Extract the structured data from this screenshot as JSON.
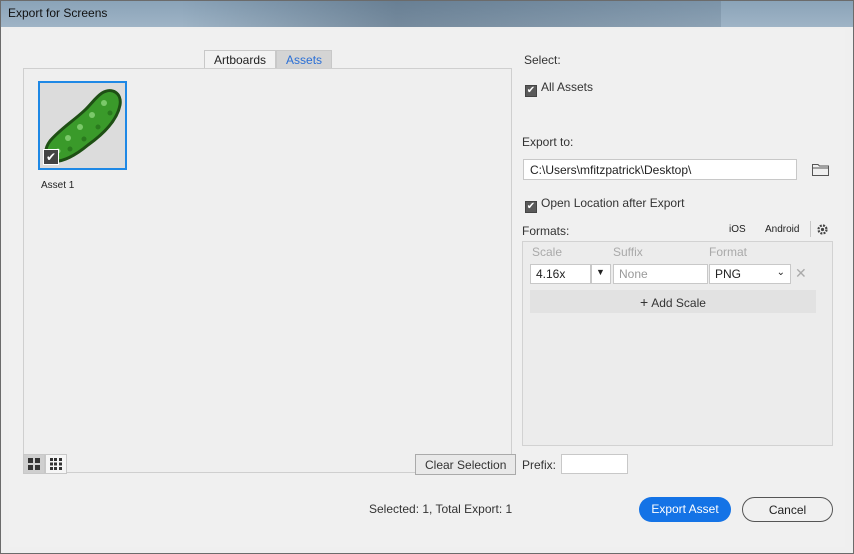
{
  "window": {
    "title": "Export for Screens"
  },
  "tabs": [
    {
      "label": "Artboards"
    },
    {
      "label": "Assets"
    }
  ],
  "assets": [
    {
      "label": "Asset 1"
    }
  ],
  "left_buttons": {
    "clear_selection": "Clear Selection"
  },
  "select": {
    "heading": "Select:",
    "all_assets": "All Assets"
  },
  "export_to": {
    "heading": "Export to:",
    "path": "C:\\Users\\mfitzpatrick\\Desktop\\",
    "open_location": "Open Location after Export"
  },
  "formats": {
    "heading": "Formats:",
    "ios": "iOS",
    "android": "Android",
    "columns": {
      "scale": "Scale",
      "suffix": "Suffix",
      "format": "Format"
    },
    "row": {
      "scale": "4.16x",
      "suffix_placeholder": "None",
      "format": "PNG"
    },
    "add_scale": "Add Scale"
  },
  "prefix": {
    "label": "Prefix:"
  },
  "status": "Selected: 1, Total Export: 1",
  "actions": {
    "export": "Export Asset",
    "cancel": "Cancel"
  },
  "colors": {
    "accent": "#1473e6",
    "selection": "#1e88e5"
  },
  "icons": [
    "folder-icon",
    "gear-icon",
    "close-icon",
    "chevron-down-icon",
    "plus-icon",
    "grid-view-icon",
    "list-view-icon",
    "checkmark-icon"
  ]
}
